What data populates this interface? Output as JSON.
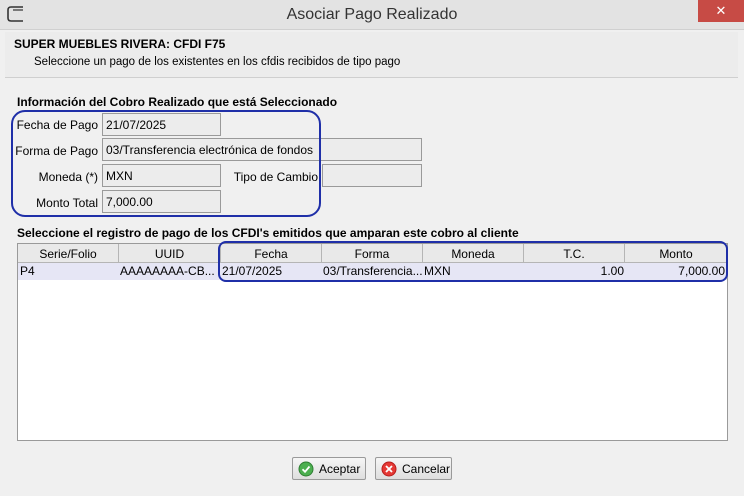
{
  "window": {
    "title": "Asociar Pago Realizado",
    "close_symbol": "✕"
  },
  "header": {
    "title": "SUPER MUEBLES RIVERA: CFDI F75",
    "subtitle": "Seleccione un pago de los existentes en los cfdis recibidos de tipo pago"
  },
  "info": {
    "section_title": "Información del Cobro Realizado que está Seleccionado",
    "fecha_label": "Fecha de Pago",
    "fecha_value": "21/07/2025",
    "forma_label": "Forma de Pago",
    "forma_value": "03/Transferencia electrónica de fondos",
    "moneda_label": "Moneda (*)",
    "moneda_value": "MXN",
    "tipo_cambio_label": "Tipo de Cambio",
    "tipo_cambio_value": "",
    "monto_label": "Monto Total",
    "monto_value": "7,000.00"
  },
  "table": {
    "section_title": "Seleccione el registro de pago de los CFDI's emitidos que amparan este cobro al cliente",
    "columns": [
      "Serie/Folio",
      "UUID",
      "Fecha",
      "Forma",
      "Moneda",
      "T.C.",
      "Monto"
    ],
    "rows": [
      {
        "serie": "P4",
        "uuid": "AAAAAAAA-CB...",
        "fecha": "21/07/2025",
        "forma": "03/Transferencia...",
        "moneda": "MXN",
        "tc": "1.00",
        "monto": "7,000.00"
      }
    ]
  },
  "buttons": {
    "accept": "Aceptar",
    "cancel": "Cancelar"
  },
  "colors": {
    "highlight": "#1f2fa8",
    "close_button": "#c74b45",
    "selected_row": "#e6e6f5"
  },
  "icons": {
    "app": "app-window-icon",
    "close": "close-icon",
    "accept": "check-circle-icon",
    "cancel": "cancel-circle-icon"
  }
}
